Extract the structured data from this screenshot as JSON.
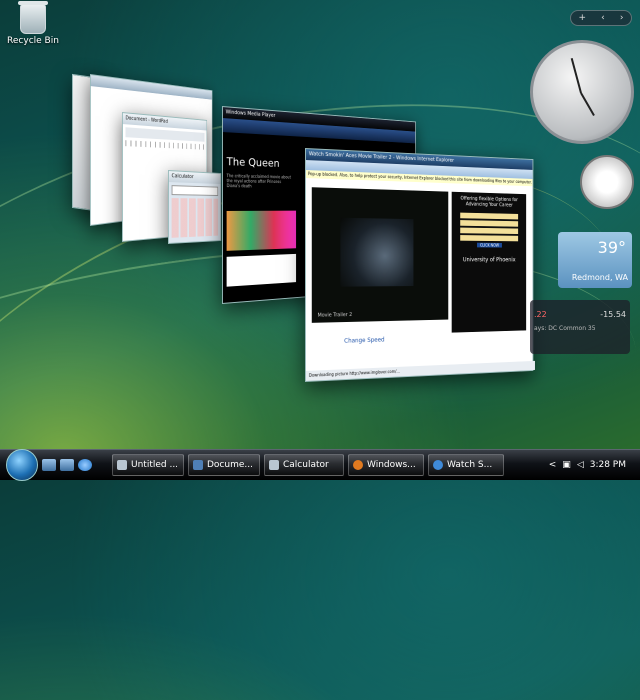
{
  "desktop": {
    "recycle_bin_label": "Recycle Bin"
  },
  "windows": {
    "media_player_title": "Windows Media Player",
    "media_player_heading": "The Queen",
    "media_player_desc": "The critically acclaimed movie about the royal actions after Princess Diana's death",
    "ie_title": "Watch Smokin' Aces Movie Trailer 2 - Windows Internet Explorer",
    "ie_infobar": "Pop-up blocked. Also, to help protect your security, Internet Explorer blocked this site from downloading files to your computer. Click here for options...",
    "ie_ad_heading": "Offering flexible Options for Advancing Your Career",
    "ie_ad_cta": "CLICK NOW",
    "ie_school": "University of Phoenix",
    "ie_video_caption": "Movie Trailer 2",
    "ie_link_title": "Change Speed",
    "ie_status": "Downloading picture http://www.imglover.com/...",
    "notepad_title": "Document - WordPad",
    "calc_title": "Calculator"
  },
  "gadgets": {
    "add_label": "+",
    "weather_temp": "39°",
    "weather_city": "Redmond, WA",
    "stock_a": "-15.54",
    "stock_b": ".22",
    "stock_c": "ays: DC Common 35"
  },
  "taskbar": {
    "items": [
      {
        "label": "Untitled ...",
        "icon_color": "#b9c6d2"
      },
      {
        "label": "Docume...",
        "icon_color": "#4f7fb5"
      },
      {
        "label": "Calculator",
        "icon_color": "#b9c6d2"
      },
      {
        "label": "Windows...",
        "icon_color": "#e07a20"
      },
      {
        "label": "Watch S...",
        "icon_color": "#3f8ad8"
      }
    ],
    "clock": "3:28 PM",
    "tray_chevron": "<"
  }
}
